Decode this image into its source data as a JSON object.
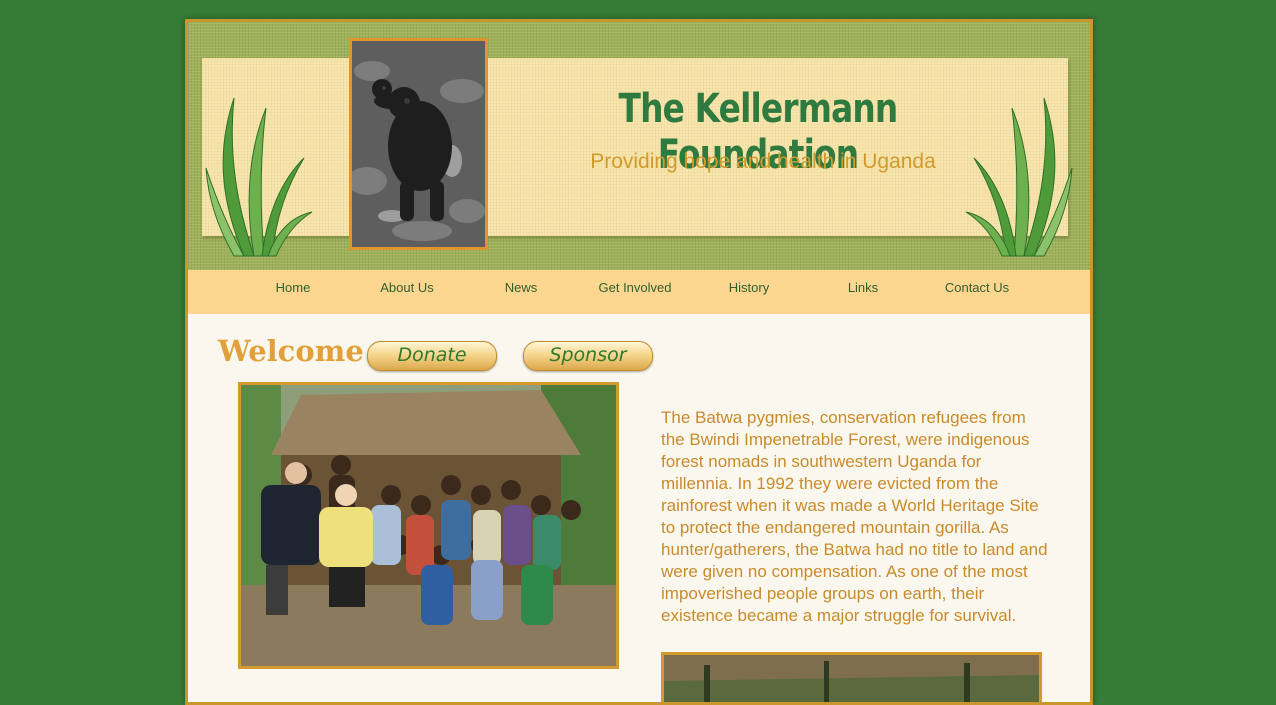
{
  "header": {
    "title": "The Kellermann Foundation",
    "tagline": "Providing hope and health in Uganda"
  },
  "nav": {
    "items": [
      "Home",
      "About Us",
      "News",
      "Get Involved",
      "History",
      "Links",
      "Contact Us"
    ]
  },
  "main": {
    "heading": "Welcome",
    "donate_label": "Donate",
    "sponsor_label": "Sponsor",
    "intro": "The Batwa pygmies, conservation refugees from the Bwindi Impenetrable Forest, were indigenous forest nomads in southwestern Uganda for millennia. In 1992 they were evicted from the rainforest when it was made a World Heritage Site to protect the endangered mountain gorilla. As hunter/gatherers, the Batwa had no title to land and were given no compensation. As one of the most impoverished people groups on earth, their existence became a major struggle for survival."
  },
  "colors": {
    "background": "#367b36",
    "title": "#2f7a3e",
    "accent": "#d19a2c",
    "nav_bar": "#fdd78f",
    "nav_text": "#2f5e2f"
  }
}
